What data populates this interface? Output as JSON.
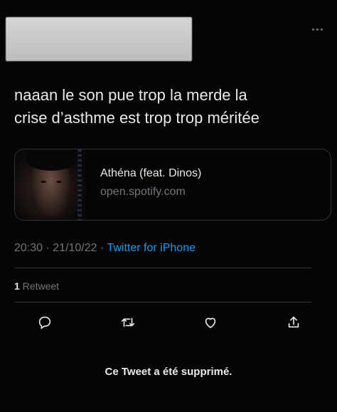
{
  "tweet": {
    "text": "naaan le son pue trop la merde la\ncrise d’asthme est trop trop méritée"
  },
  "card": {
    "title": "Athéna (feat. Dinos)",
    "domain": "open.spotify.com"
  },
  "meta": {
    "time": "20:30",
    "sep1": " · ",
    "date": "21/10/22",
    "sep2": " · ",
    "source": "Twitter for iPhone"
  },
  "stats": {
    "retweet_count": "1",
    "retweet_label": " Retweet"
  },
  "actions": [
    "reply-icon",
    "retweet-icon",
    "like-icon",
    "share-icon"
  ],
  "footer": {
    "deleted_notice": "Ce Tweet a été supprimé."
  },
  "colors": {
    "background": "#050505",
    "text": "#e7e9ea",
    "muted": "#71767b",
    "accent": "#1d9bf0",
    "divider": "#2f3336"
  }
}
